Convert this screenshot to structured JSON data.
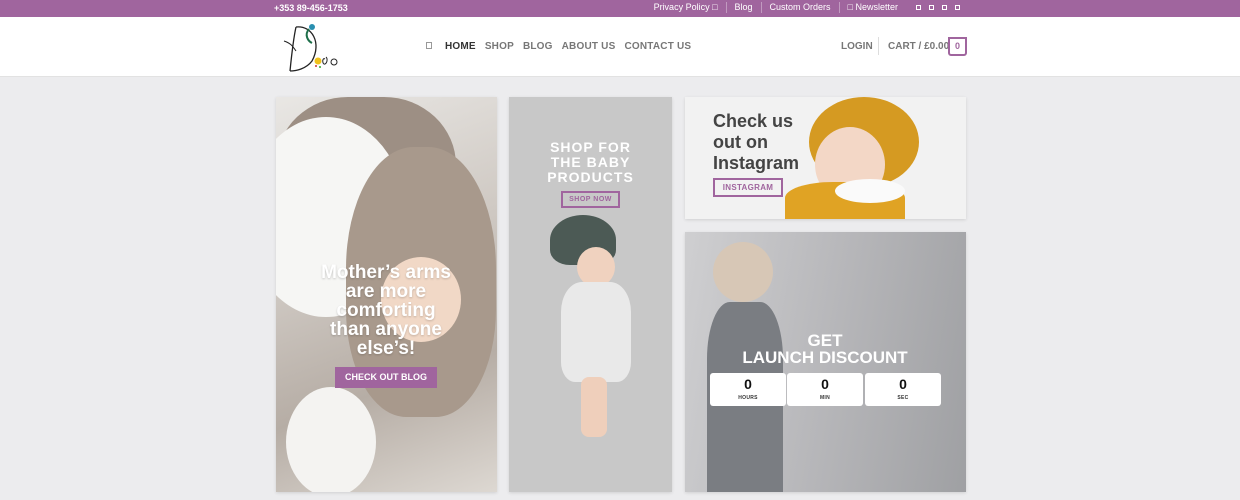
{
  "topbar": {
    "phone": "+353 89-456-1753",
    "links": [
      {
        "label": "Privacy Policy □"
      },
      {
        "label": "Blog"
      },
      {
        "label": "Custom Orders"
      },
      {
        "label": "□ Newsletter"
      }
    ],
    "social_icons": [
      "social-icon-1",
      "social-icon-2",
      "social-icon-3",
      "social-icon-4"
    ]
  },
  "header": {
    "logo_text": "Dodo",
    "nav": [
      {
        "label": "HOME",
        "active": true
      },
      {
        "label": "SHOP"
      },
      {
        "label": "BLOG"
      },
      {
        "label": "ABOUT US"
      },
      {
        "label": "CONTACT US"
      }
    ],
    "login": "LOGIN",
    "cart": "CART / £0.00",
    "cart_count": "0"
  },
  "banners": {
    "blog": {
      "headline_lines": [
        "Mother’s arms",
        "are more",
        "comforting",
        "than anyone",
        "else’s!"
      ],
      "button": "CHECK OUT BLOG"
    },
    "shop": {
      "headline_lines": [
        "SHOP FOR",
        "THE BABY",
        "PRODUCTS"
      ],
      "button": "SHOP NOW"
    },
    "instagram": {
      "headline_lines": [
        "Check us",
        "out on",
        "Instagram"
      ],
      "button": "INSTAGRAM"
    },
    "discount": {
      "headline_lines": [
        "GET",
        "LAUNCH DISCOUNT"
      ],
      "countdown": [
        {
          "value": "0",
          "label": "HOURS"
        },
        {
          "value": "0",
          "label": "MIN"
        },
        {
          "value": "0",
          "label": "SEC"
        }
      ]
    }
  },
  "colors": {
    "accent": "#a0659e",
    "background": "#ececee"
  }
}
